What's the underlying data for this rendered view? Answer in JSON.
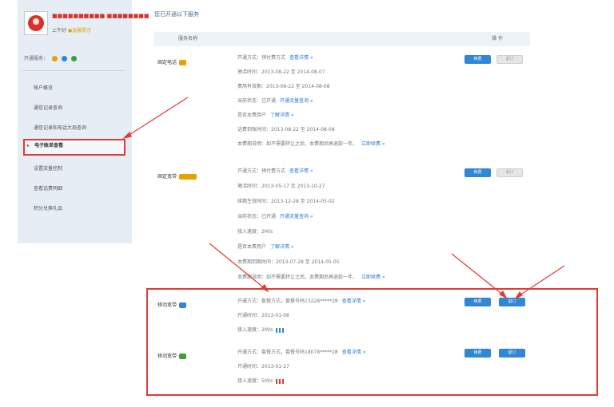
{
  "sidebar": {
    "username": "■■■■■■■■■■ ■■■■■■■■",
    "level_prefix": "上午好",
    "level_badge": "●温馨提示",
    "services_label": "开通服务：",
    "menu": [
      {
        "label": "帐户概览"
      },
      {
        "label": "通信记录查询"
      },
      {
        "label": "通信记录和电话大局查询"
      },
      {
        "label": "电子账单查看",
        "active": true
      },
      {
        "label": "设置流量控制"
      },
      {
        "label": "查看话费明细"
      },
      {
        "label": "积分兑换礼品"
      }
    ]
  },
  "page": {
    "title": "您已开通以下服务",
    "col_name": "服务名称",
    "col_action": "操 作"
  },
  "products": [
    {
      "name": "固定电话",
      "icon_color": "#e8a100",
      "lines": [
        {
          "text": "开通方式：预付费方式",
          "link": "查看详情 »"
        },
        {
          "text": "激活时间：2013-08-22 至 2014-08-07"
        },
        {
          "text": "费用有效期：2013-08-22 至 2014-08-08"
        },
        {
          "text": "当前状态：已开通",
          "link": "开通流量查询 »"
        },
        {
          "text": "是否本费用户",
          "link": "了解详情 »"
        },
        {
          "text": "话费到账时间：2013-08-22 至 2014-08-08"
        },
        {
          "text": "本费期说明：如不需要转让之后，本费期后再退款一年。",
          "link": "立即续费 »"
        }
      ],
      "btn_primary": "续费",
      "btn_secondary": "退订"
    },
    {
      "name": "固定宽带",
      "icon_color": "#e8a100",
      "lines": [
        {
          "text": "开通方式：预付费方式",
          "link": "查看详情 »"
        },
        {
          "text": "激活时间：2013-05-17 至 2013-10-27"
        },
        {
          "text": "续期生效时间：2013-12-28 至 2014-05-02"
        },
        {
          "text": "当前状态：已开通",
          "link": "开通流量查询 »"
        },
        {
          "text": "接入速度：2M/s"
        },
        {
          "text": "是否本费用户",
          "link": "了解详情 »"
        },
        {
          "text": "本费期到期时间：2013-07-28 至 2014-05-05"
        },
        {
          "text": "本费期说明：如不需要转让之后，本费期后再退款一年。",
          "link": "立即续费 »"
        }
      ],
      "btn_primary": "续费",
      "btn_secondary": "退订"
    },
    {
      "name": "移动宽带",
      "icon_color": "#2f87d6",
      "lines": [
        {
          "text": "开通方式：套餐方式，套餐号码13228*****28",
          "link": "查看详情 »"
        },
        {
          "text": "开通时间：2013-01-08"
        },
        {
          "text": "接入速度：2M/s",
          "signal": "blue"
        }
      ],
      "btn_primary": "续费",
      "btn_secondary": "退订"
    },
    {
      "name": "移动宽带",
      "icon_color": "#3aa03a",
      "lines": [
        {
          "text": "开通方式：套餐方式，套餐号码18078*****28",
          "link": "查看详情 »"
        },
        {
          "text": "开通时间：2013-01-27"
        },
        {
          "text": "接入速度：5M/s",
          "signal": "red"
        }
      ],
      "btn_primary": "续费",
      "btn_secondary": "退订"
    }
  ]
}
